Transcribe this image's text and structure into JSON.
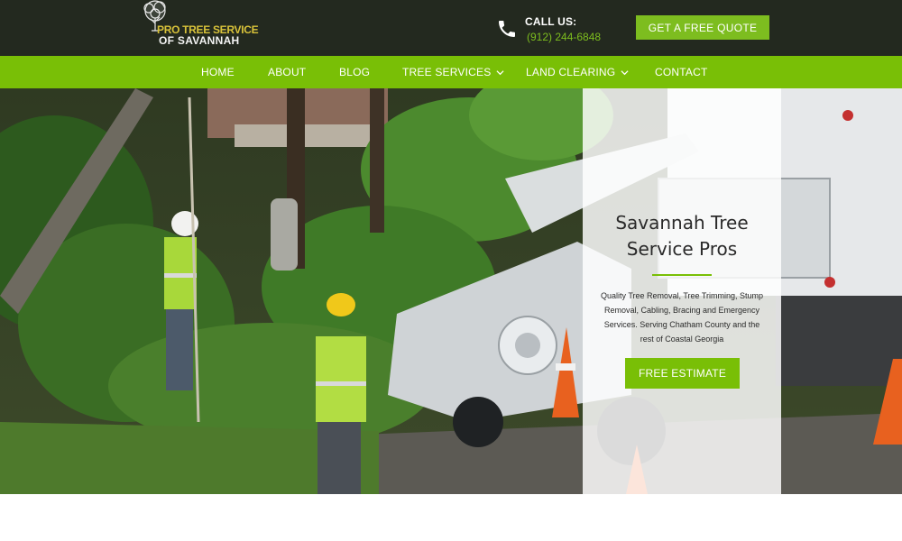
{
  "brand": {
    "line1": "PRO TREE SERVICE",
    "line2": "OF SAVANNAH"
  },
  "header": {
    "call_label": "CALL US:",
    "phone": "(912) 244-6848",
    "quote_button": "GET A FREE QUOTE"
  },
  "nav": {
    "items": [
      {
        "label": "HOME"
      },
      {
        "label": "ABOUT"
      },
      {
        "label": "BLOG"
      },
      {
        "label": "TREE SERVICES"
      },
      {
        "label": "LAND CLEARING"
      },
      {
        "label": "CONTACT"
      }
    ]
  },
  "hero": {
    "title_line1": "Savannah Tree",
    "title_line2": "Service Pros",
    "description": "Quality Tree Removal, Tree Trimming, Stump Removal, Cabling, Bracing and Emergency Services. Serving Chatham County and the rest of Coastal Georgia",
    "button": "FREE ESTIMATE"
  },
  "icons": {
    "phone": "phone-icon",
    "dropdown": "chevron-down-icon",
    "logo": "tree-logo-icon"
  },
  "colors": {
    "header_bg": "#23291f",
    "accent_green": "#79bf06",
    "phone_green": "#7dbd1f"
  }
}
